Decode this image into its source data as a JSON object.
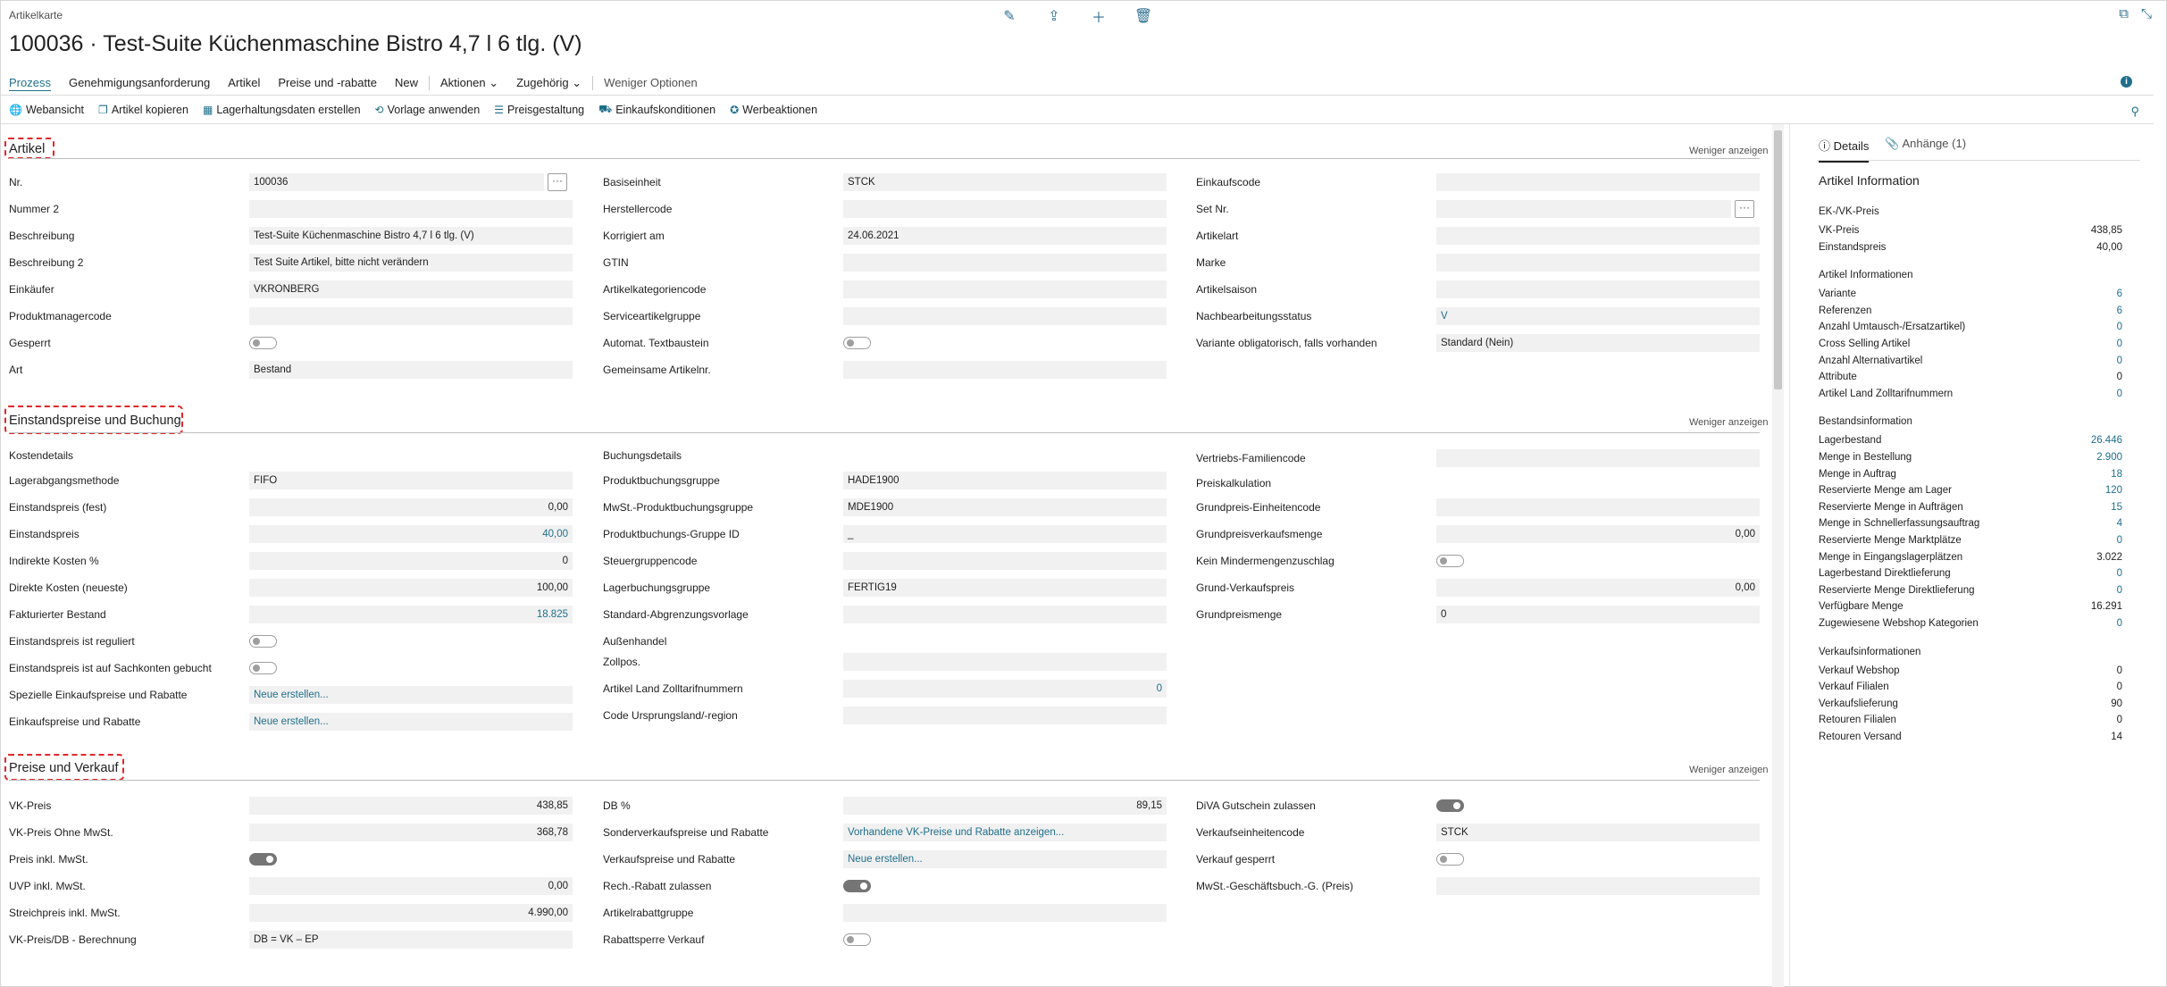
{
  "window": {
    "breadcrumb": "Artikelkarte",
    "title": "100036 · Test-Suite Küchenmaschine Bistro 4,7 l 6 tlg. (V)"
  },
  "toolbar": {
    "edit_icon": "pencil-icon",
    "share_icon": "share-icon",
    "add_icon": "plus-icon",
    "delete_icon": "trash-icon"
  },
  "actions": [
    "Prozess",
    "Genehmigungsanforderung",
    "Artikel",
    "Preise und -rabatte",
    "New",
    "Aktionen",
    "Zugehörig",
    "Weniger Optionen"
  ],
  "promoted": [
    "Webansicht",
    "Artikel kopieren",
    "Lagerhaltungsdaten erstellen",
    "Vorlage anwenden",
    "Preisgestaltung",
    "Einkaufskonditionen",
    "Werbeaktionen"
  ],
  "less_show": "Weniger anzeigen",
  "artikel": {
    "title": "Artikel",
    "col1": [
      {
        "label": "Nr.",
        "value": "100036"
      },
      {
        "label": "Nummer 2",
        "value": ""
      },
      {
        "label": "Beschreibung",
        "value": "Test-Suite Küchenmaschine Bistro 4,7 l 6 tlg. (V)"
      },
      {
        "label": "Beschreibung 2",
        "value": "Test Suite Artikel, bitte nicht verändern"
      },
      {
        "label": "Einkäufer",
        "value": "VKRONBERG"
      },
      {
        "label": "Produktmanagercode",
        "value": ""
      },
      {
        "label": "Gesperrt",
        "value": ""
      },
      {
        "label": "Art",
        "value": "Bestand"
      }
    ],
    "col2": [
      {
        "label": "Basiseinheit",
        "value": "STCK"
      },
      {
        "label": "Herstellercode",
        "value": ""
      },
      {
        "label": "Korrigiert am",
        "value": "24.06.2021"
      },
      {
        "label": "GTIN",
        "value": ""
      },
      {
        "label": "Artikelkategoriencode",
        "value": ""
      },
      {
        "label": "Serviceartikelgruppe",
        "value": ""
      },
      {
        "label": "Automat. Textbaustein",
        "value": ""
      },
      {
        "label": "Gemeinsame Artikelnr.",
        "value": ""
      }
    ],
    "col3": [
      {
        "label": "Einkaufscode",
        "value": ""
      },
      {
        "label": "Set Nr.",
        "value": ""
      },
      {
        "label": "Artikelart",
        "value": ""
      },
      {
        "label": "Marke",
        "value": ""
      },
      {
        "label": "Artikelsaison",
        "value": ""
      },
      {
        "label": "Nachbearbeitungsstatus",
        "value": "V"
      },
      {
        "label": "Variante obligatorisch, falls vorhanden",
        "value": "Standard (Nein)"
      }
    ]
  },
  "einstand": {
    "title": "Einstandspreise und Buchung",
    "sub1": "Kostendetails",
    "sub2": "Buchungsdetails",
    "sub3": "Außenhandel",
    "sub4": "Preiskalkulation",
    "col1": [
      {
        "label": "Lagerabgangsmethode",
        "value": "FIFO"
      },
      {
        "label": "Einstandspreis (fest)",
        "value": "0,00"
      },
      {
        "label": "Einstandspreis",
        "value": "40,00"
      },
      {
        "label": "Indirekte Kosten %",
        "value": "0"
      },
      {
        "label": "Direkte Kosten (neueste)",
        "value": "100,00"
      },
      {
        "label": "Fakturierter Bestand",
        "value": "18.825"
      },
      {
        "label": "Einstandspreis ist reguliert",
        "value": ""
      },
      {
        "label": "Einstandspreis ist auf Sachkonten gebucht",
        "value": ""
      },
      {
        "label": "Spezielle Einkaufspreise und Rabatte",
        "value": "Neue erstellen..."
      },
      {
        "label": "Einkaufspreise und Rabatte",
        "value": "Neue erstellen..."
      }
    ],
    "col2": [
      {
        "label": "Produktbuchungsgruppe",
        "value": "HADE1900"
      },
      {
        "label": "MwSt.-Produktbuchungsgruppe",
        "value": "MDE1900"
      },
      {
        "label": "Produktbuchungs-Gruppe ID",
        "value": "_"
      },
      {
        "label": "Steuergruppencode",
        "value": ""
      },
      {
        "label": "Lagerbuchungsgruppe",
        "value": "FERTIG19"
      },
      {
        "label": "Standard-Abgrenzungsvorlage",
        "value": ""
      },
      {
        "label": "Zollpos.",
        "value": ""
      },
      {
        "label": "Artikel Land Zolltarifnummern",
        "value": "0"
      },
      {
        "label": "Code Ursprungsland/-region",
        "value": ""
      }
    ],
    "col3": [
      {
        "label": "Vertriebs-Familiencode",
        "value": ""
      },
      {
        "label": "Grundpreis-Einheitencode",
        "value": ""
      },
      {
        "label": "Grundpreisverkaufsmenge",
        "value": "0,00"
      },
      {
        "label": "Kein Mindermengenzuschlag",
        "value": ""
      },
      {
        "label": "Grund-Verkaufspreis",
        "value": "0,00"
      },
      {
        "label": "Grundpreismenge",
        "value": "0"
      }
    ]
  },
  "preise": {
    "title": "Preise und Verkauf",
    "col1": [
      {
        "label": "VK-Preis",
        "value": "438,85"
      },
      {
        "label": "VK-Preis Ohne MwSt.",
        "value": "368,78"
      },
      {
        "label": "Preis inkl. MwSt.",
        "value": ""
      },
      {
        "label": "UVP inkl. MwSt.",
        "value": "0,00"
      },
      {
        "label": "Streichpreis inkl. MwSt.",
        "value": "4.990,00"
      },
      {
        "label": "VK-Preis/DB - Berechnung",
        "value": "DB = VK – EP"
      }
    ],
    "col2": [
      {
        "label": "DB %",
        "value": "89,15"
      },
      {
        "label": "Sonderverkaufspreise und Rabatte",
        "value": "Vorhandene VK-Preise und Rabatte anzeigen..."
      },
      {
        "label": "Verkaufspreise und Rabatte",
        "value": "Neue erstellen..."
      },
      {
        "label": "Rech.-Rabatt zulassen",
        "value": ""
      },
      {
        "label": "Artikelrabattgruppe",
        "value": ""
      },
      {
        "label": "Rabattsperre Verkauf",
        "value": ""
      }
    ],
    "col3": [
      {
        "label": "DiVA Gutschein zulassen",
        "value": ""
      },
      {
        "label": "Verkaufseinheitencode",
        "value": "STCK"
      },
      {
        "label": "Verkauf gesperrt",
        "value": ""
      },
      {
        "label": "MwSt.-Geschäftsbuch.-G. (Preis)",
        "value": ""
      }
    ]
  },
  "factbox": {
    "tab_details": "Details",
    "tab_attachments": "Anhänge (1)",
    "heading": "Artikel Information",
    "groups": [
      {
        "title": "EK-/VK-Preis",
        "rows": [
          {
            "k": "VK-Preis",
            "v": "438,85",
            "link": false
          },
          {
            "k": "Einstandspreis",
            "v": "40,00",
            "link": false
          }
        ]
      },
      {
        "title": "Artikel Informationen",
        "rows": [
          {
            "k": "Variante",
            "v": "6",
            "link": true
          },
          {
            "k": "Referenzen",
            "v": "6",
            "link": true
          },
          {
            "k": "Anzahl Umtausch-/Ersatzartikel)",
            "v": "0",
            "link": true
          },
          {
            "k": "Cross Selling Artikel",
            "v": "0",
            "link": true
          },
          {
            "k": "Anzahl Alternativartikel",
            "v": "0",
            "link": true
          },
          {
            "k": "Attribute",
            "v": "0",
            "link": false
          },
          {
            "k": "Artikel Land Zolltarifnummern",
            "v": "0",
            "link": true
          }
        ]
      },
      {
        "title": "Bestandsinformation",
        "rows": [
          {
            "k": "Lagerbestand",
            "v": "26.446",
            "link": true
          },
          {
            "k": "Menge in Bestellung",
            "v": "2.900",
            "link": true
          },
          {
            "k": "Menge in Auftrag",
            "v": "18",
            "link": true
          },
          {
            "k": "Reservierte Menge am Lager",
            "v": "120",
            "link": true
          },
          {
            "k": "Reservierte Menge in Aufträgen",
            "v": "15",
            "link": true
          },
          {
            "k": "Menge in Schnellerfassungsauftrag",
            "v": "4",
            "link": true
          },
          {
            "k": "Reservierte Menge Marktplätze",
            "v": "0",
            "link": true
          },
          {
            "k": "Menge in Eingangslagerplätzen",
            "v": "3.022",
            "link": false
          },
          {
            "k": "Lagerbestand Direktlieferung",
            "v": "0",
            "link": true
          },
          {
            "k": "Reservierte Menge Direktlieferung",
            "v": "0",
            "link": true
          },
          {
            "k": "Verfügbare Menge",
            "v": "16.291",
            "link": false
          },
          {
            "k": "Zugewiesene Webshop Kategorien",
            "v": "0",
            "link": true
          }
        ]
      },
      {
        "title": "Verkaufsinformationen",
        "rows": [
          {
            "k": "Verkauf Webshop",
            "v": "0",
            "link": false
          },
          {
            "k": "Verkauf Filialen",
            "v": "0",
            "link": false
          },
          {
            "k": "Verkaufslieferung",
            "v": "90",
            "link": false
          },
          {
            "k": "Retouren Filialen",
            "v": "0",
            "link": false
          },
          {
            "k": "Retouren Versand",
            "v": "14",
            "link": false
          }
        ]
      }
    ]
  }
}
